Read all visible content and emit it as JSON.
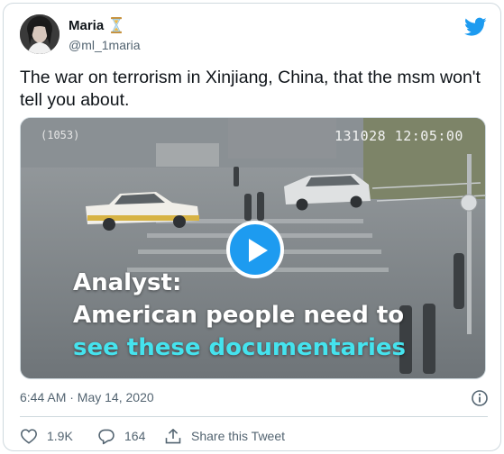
{
  "author": {
    "display_name": "Maria",
    "handle": "@ml_1maria",
    "badge_icon": "hourglass-icon"
  },
  "tweet": {
    "text": "The war on terrorism in Xinjiang, China, that the msm won't tell you about."
  },
  "media": {
    "type": "video",
    "osd_left": "(1053)",
    "osd_right": "131028  12:05:00",
    "caption_lines": [
      "Analyst:",
      "American people need to",
      "see these documentaries"
    ],
    "caption_highlight_color": "#45e3ee",
    "play_icon": "play-icon"
  },
  "meta": {
    "timestamp": "6:44 AM · May 14, 2020"
  },
  "actions": {
    "like_count": "1.9K",
    "reply_count": "164",
    "share_label": "Share this Tweet"
  },
  "colors": {
    "brand_blue": "#1d9bf0",
    "like_red": "#f91880",
    "secondary_text": "#536471"
  }
}
